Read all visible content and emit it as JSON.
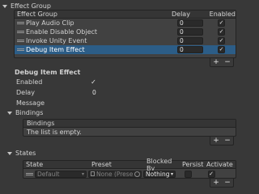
{
  "effect_group": {
    "foldout_label": "Effect Group",
    "columns": {
      "name": "Effect Group",
      "delay": "Delay",
      "enabled": "Enabled"
    },
    "rows": [
      {
        "name": "Play Audio Clip",
        "delay": "0",
        "enabled": "✓"
      },
      {
        "name": "Enable Disable Object",
        "delay": "0",
        "enabled": "✓"
      },
      {
        "name": "Invoke Unity Event",
        "delay": "0",
        "enabled": "✓"
      },
      {
        "name": "Debug Item Effect",
        "delay": "0",
        "enabled": "✓"
      }
    ],
    "selected_row": "Debug Item Effect"
  },
  "buttons": {
    "add": "+",
    "remove": "−"
  },
  "debug_item_effect": {
    "title": "Debug Item Effect",
    "enabled_label": "Enabled",
    "enabled_value": "✓",
    "delay_label": "Delay",
    "delay_value": "0",
    "message_label": "Message",
    "message_value": ""
  },
  "bindings": {
    "foldout_label": "Bindings",
    "header": "Bindings",
    "empty_text": "The list is empty."
  },
  "states": {
    "foldout_label": "States",
    "columns": {
      "state": "State",
      "preset": "Preset",
      "blocked_by": "Blocked By",
      "persist": "Persist",
      "activate": "Activate"
    },
    "row": {
      "state": "Default",
      "preset": "None (Prese",
      "blocked_by": "Nothing",
      "persist": "",
      "activate": "✓"
    }
  },
  "icons": {
    "foldout": "triangle-down-icon",
    "drag": "drag-handle-icon",
    "object": "scriptable-object-icon",
    "picker": "object-picker-icon",
    "dropdown": "chevron-down-icon"
  },
  "colors": {
    "background": "#383838",
    "panel": "#414141",
    "header": "#353535",
    "field": "#2a2a2a",
    "selection": "#2c5d87",
    "text": "#d2d2d2"
  }
}
